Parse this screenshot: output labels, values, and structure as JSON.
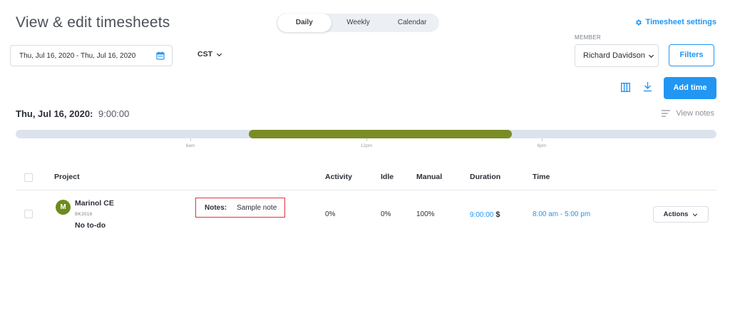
{
  "header": {
    "title": "View & edit timesheets",
    "view_tabs": [
      {
        "label": "Daily",
        "active": true
      },
      {
        "label": "Weekly",
        "active": false
      },
      {
        "label": "Calendar",
        "active": false
      }
    ],
    "settings_link": "Timesheet settings",
    "settings_icon": "gear-icon"
  },
  "filters": {
    "date_range": "Thu, Jul 16, 2020 - Thu, Jul 16, 2020",
    "timezone": "CST",
    "member_label": "MEMBER",
    "member_value": "Richard Davidson",
    "filters_button": "Filters"
  },
  "toolbar": {
    "add_time_button": "Add time"
  },
  "day": {
    "date_label": "Thu, Jul 16, 2020:",
    "total": "9:00:00",
    "view_notes": "View notes"
  },
  "timeline": {
    "ticks": [
      "6am",
      "12pm",
      "6pm"
    ],
    "track_color": "#dde3ee",
    "fill_color": "#7a8c27"
  },
  "table": {
    "headers": {
      "project": "Project",
      "activity": "Activity",
      "idle": "Idle",
      "manual": "Manual",
      "duration": "Duration",
      "time": "Time"
    },
    "rows": [
      {
        "avatar_letter": "M",
        "project": "Marinol CE",
        "code": "BK2018",
        "todo": "No to-do",
        "notes_label": "Notes:",
        "notes_value": "Sample note",
        "activity": "0%",
        "idle": "0%",
        "manual": "100%",
        "duration": "9:00:00",
        "duration_currency": "$",
        "time": "8:00 am - 5:00 pm",
        "actions": "Actions"
      }
    ]
  },
  "colors": {
    "accent": "#2196f3",
    "avatar": "#6f8a1d",
    "notes_highlight": "#e0353f"
  }
}
